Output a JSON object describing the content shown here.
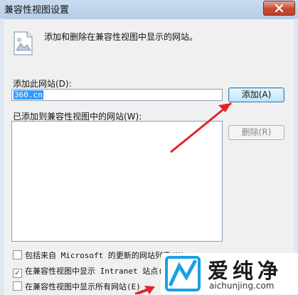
{
  "window": {
    "title": "兼容性视图设置"
  },
  "intro_text": "添加和删除在兼容性视图中显示的网站。",
  "add_site": {
    "label": "添加此网站(D):",
    "value": "360.cn"
  },
  "buttons": {
    "add": "添加(A)",
    "remove": "删除(R)"
  },
  "list_label": "已添加到兼容性视图中的网站(W):",
  "checkboxes": [
    {
      "label": "包括来自 Microsoft 的更新的网站列表(U)",
      "checked": false
    },
    {
      "label": "在兼容性视图中显示 Intranet 站点(I)",
      "checked": true
    },
    {
      "label": "在兼容性视图中显示所有网站(E)",
      "checked": false
    }
  ],
  "watermark": {
    "brand": "爱纯净",
    "domain": "aichunjing.com"
  },
  "colors": {
    "arrow": "#e0252b",
    "selection": "#3399ff",
    "close": "#c74b34"
  },
  "icons": [
    "site-page-icon",
    "close-icon",
    "brand-logo-icon"
  ]
}
